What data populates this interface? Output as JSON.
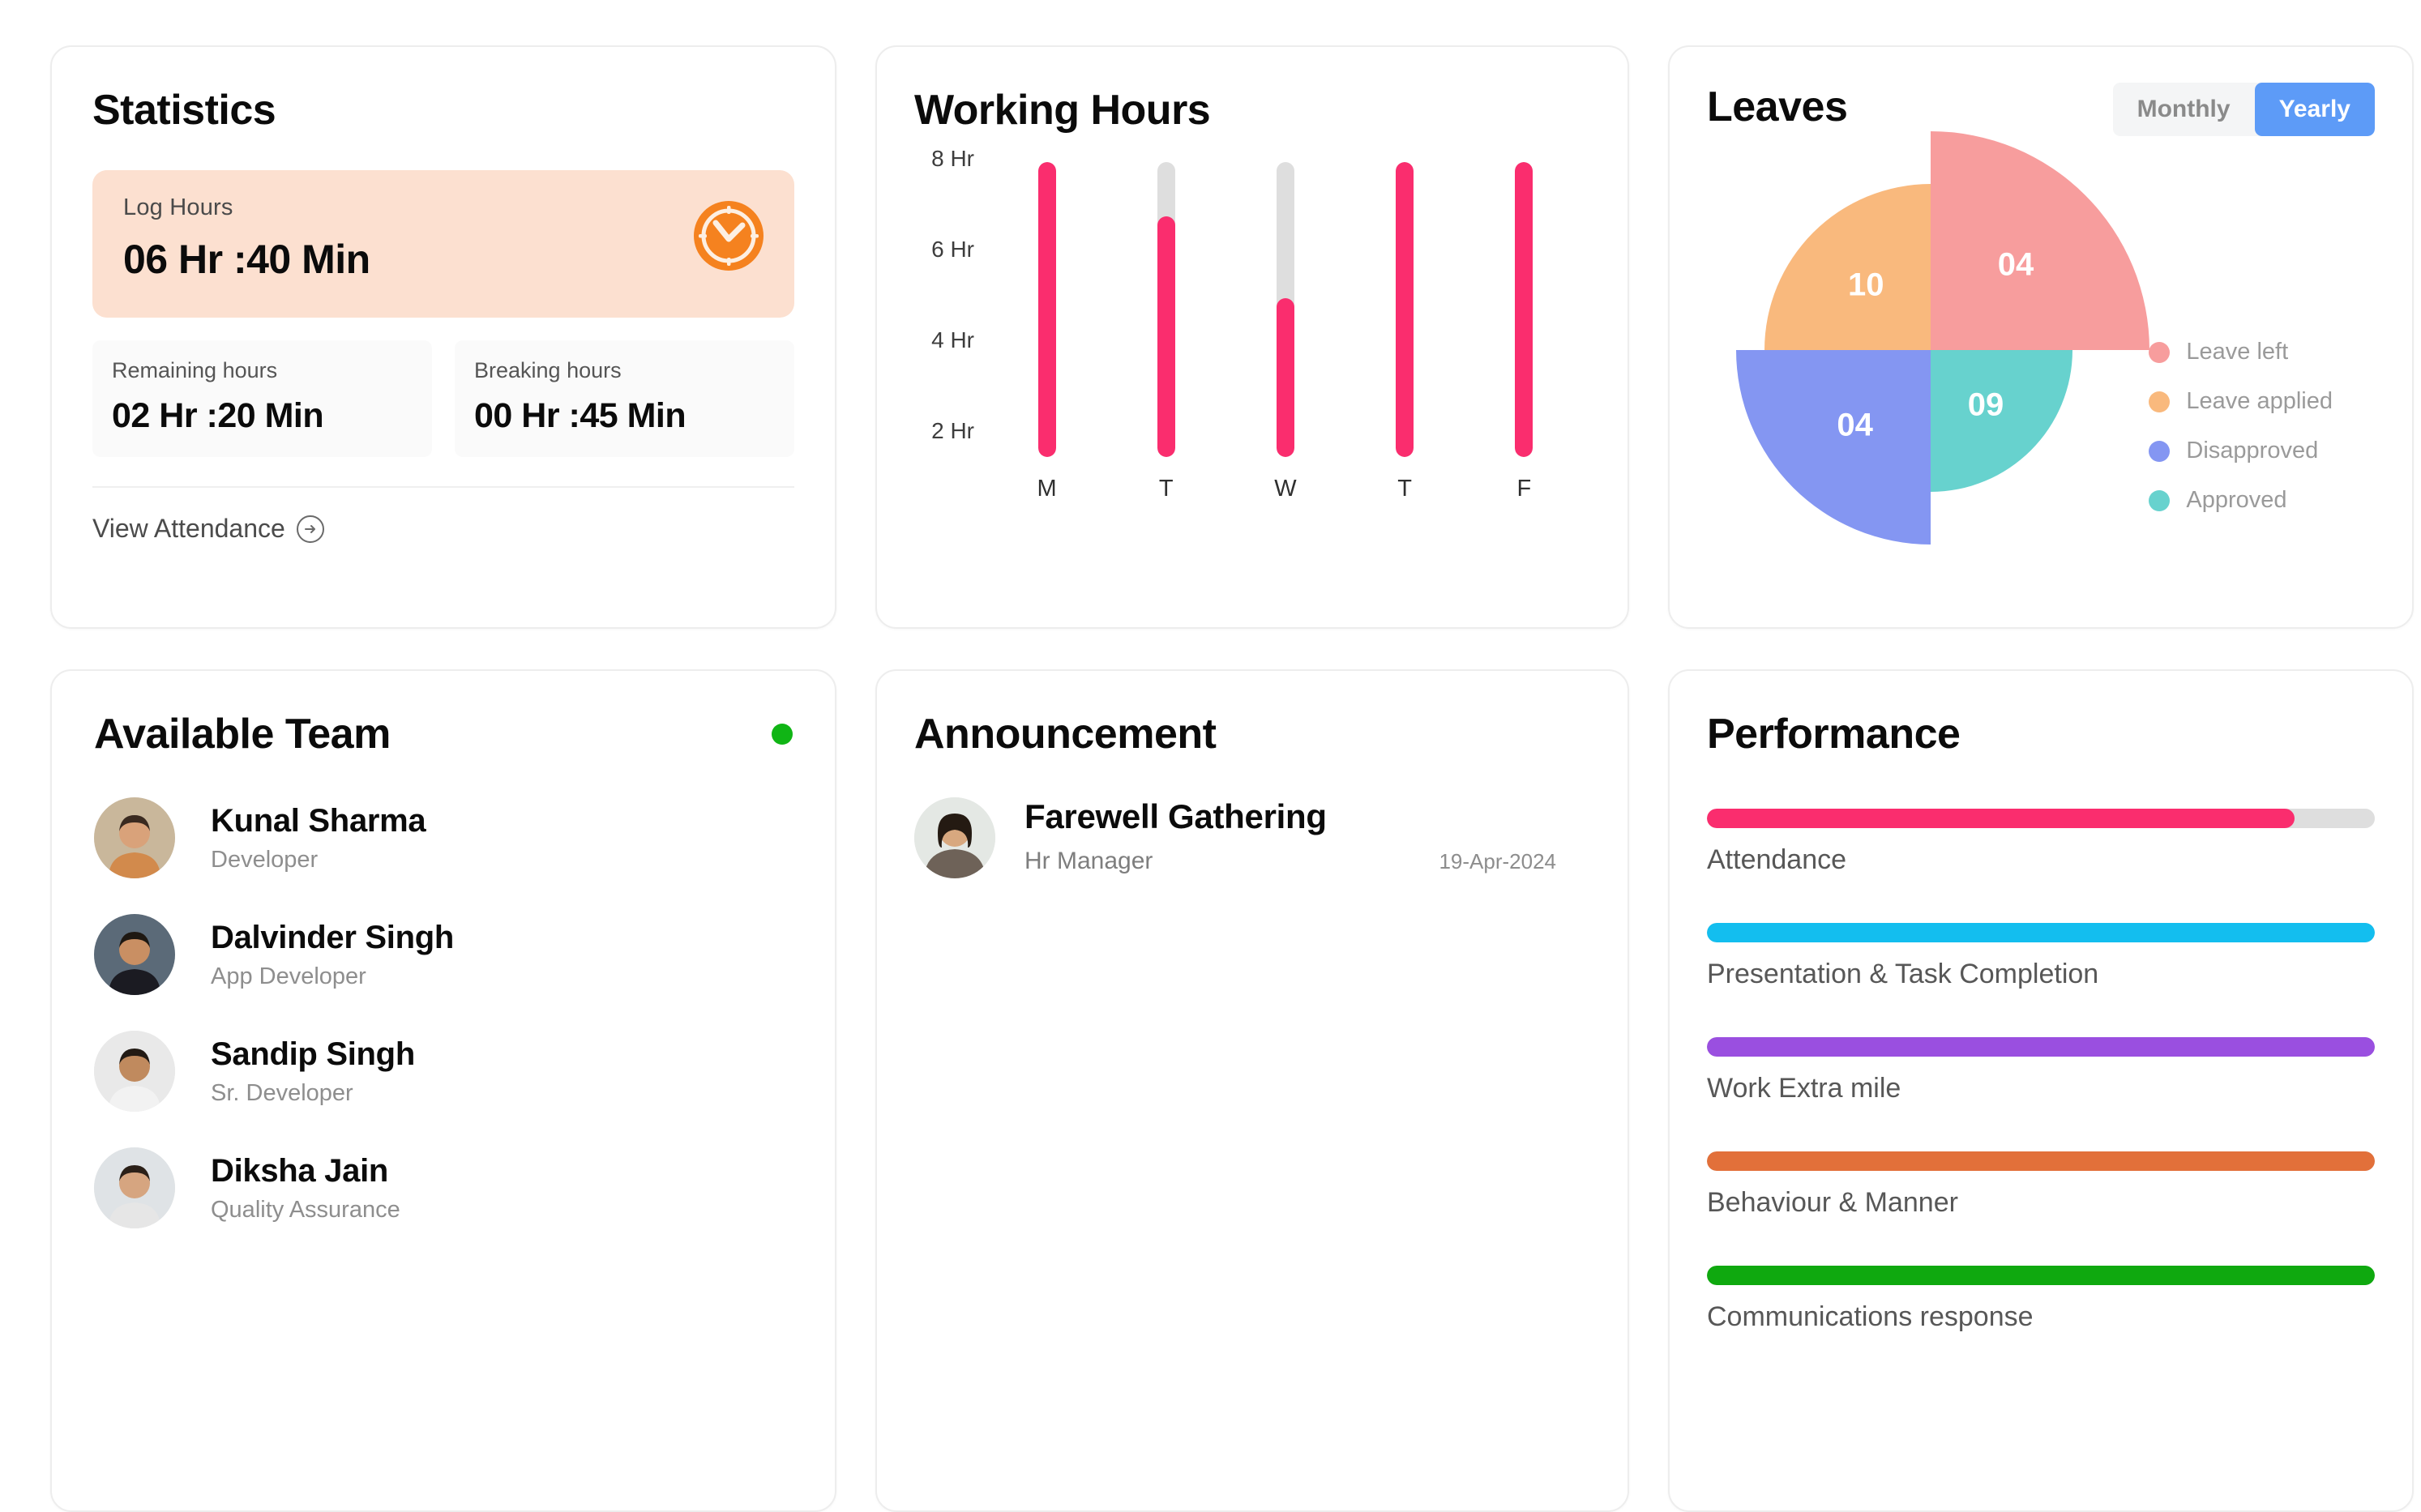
{
  "statistics": {
    "title": "Statistics",
    "log_hours": {
      "label": "Log Hours",
      "value": "06  Hr :40 Min",
      "bg_color": "#FCE0D0",
      "icon": "clock-icon",
      "icon_color": "#F5821F"
    },
    "remaining": {
      "label": "Remaining hours",
      "value": "02  Hr :20 Min"
    },
    "breaking": {
      "label": "Breaking hours",
      "value": "00  Hr :45 Min"
    },
    "view_attendance": "View Attendance"
  },
  "working_hours": {
    "title": "Working Hours"
  },
  "leaves": {
    "title": "Leaves",
    "toggle": {
      "monthly": "Monthly",
      "yearly": "Yearly",
      "selected": "Yearly",
      "active_color": "#5D9BF7"
    }
  },
  "team": {
    "title": "Available Team",
    "status_color": "#10B515",
    "members": [
      {
        "name": "Kunal Sharma",
        "role": "Developer"
      },
      {
        "name": "Dalvinder Singh",
        "role": "App Developer"
      },
      {
        "name": "Sandip Singh",
        "role": "Sr. Developer"
      },
      {
        "name": "Diksha Jain",
        "role": "Quality Assurance"
      }
    ]
  },
  "announcement": {
    "title": "Announcement",
    "items": [
      {
        "title": "Farewell Gathering",
        "role": "Hr Manager",
        "date": "19-Apr-2024"
      }
    ]
  },
  "performance": {
    "title": "Performance"
  },
  "chart_data": [
    {
      "type": "bar",
      "title": "Working Hours",
      "categories": [
        "M",
        "T",
        "W",
        "T",
        "F"
      ],
      "values": [
        8.5,
        7.3,
        5.5,
        8.5,
        8.5
      ],
      "track_max": 8.5,
      "xlabel": "",
      "ylabel": "",
      "ylim": [
        2,
        8.5
      ],
      "yticks": [
        2,
        4,
        6,
        8
      ],
      "ytick_labels": [
        "2 Hr",
        "4 Hr",
        "6 Hr",
        "8 Hr"
      ],
      "grid": false,
      "legend": "none",
      "fill_color": "#FA2D6E",
      "track_color": "#DEDEDE"
    },
    {
      "type": "pie",
      "variant": "polar-area",
      "title": "Leaves",
      "labels": [
        "Leave left",
        "Leave applied",
        "Disapproved",
        "Approved"
      ],
      "values": [
        4,
        10,
        4,
        9
      ],
      "display_values": [
        "04",
        "10",
        "04",
        "09"
      ],
      "colors": [
        "#F79D9D",
        "#F9B97D",
        "#8496F2",
        "#67D2CE"
      ],
      "quadrants": [
        "top-right",
        "top-left",
        "bottom-left",
        "bottom-right"
      ],
      "radii": [
        270,
        205,
        240,
        175
      ],
      "legend": "right"
    },
    {
      "type": "bar",
      "variant": "horizontal-progress",
      "title": "Performance",
      "categories": [
        "Attendance",
        "Presentation & Task Completion",
        "Work Extra mile",
        "Behaviour & Manner",
        "Communications response"
      ],
      "values": [
        88,
        100,
        100,
        100,
        100
      ],
      "colors": [
        "#FA2D6E",
        "#13BEEF",
        "#9A4FE0",
        "#E2703A",
        "#0FA90F"
      ],
      "track_color": "#DEDEDE",
      "ylim": [
        0,
        100
      ],
      "grid": false,
      "legend": "none"
    }
  ]
}
